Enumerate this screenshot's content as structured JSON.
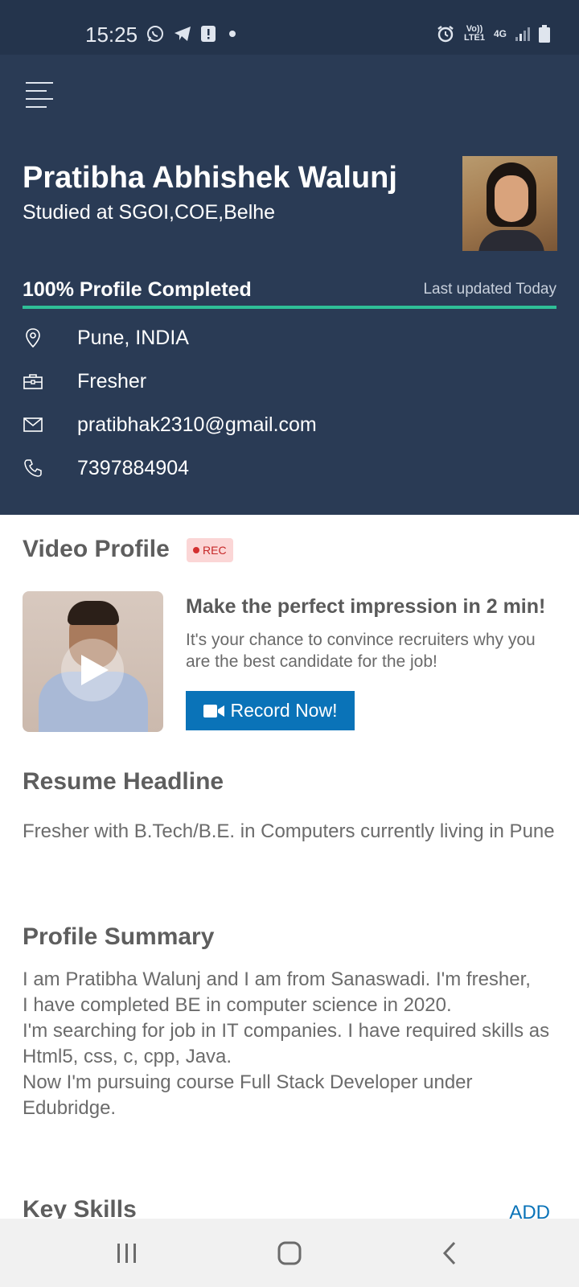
{
  "status_bar": {
    "time": "15:25",
    "left_icons": [
      "whatsapp-icon",
      "telegram-icon",
      "alert-icon",
      "dot-icon"
    ],
    "right_icons": [
      "alarm-icon",
      "volte-icon",
      "4g-icon",
      "signal-icon",
      "battery-icon"
    ],
    "volte_label": "Vo)) LTE1",
    "network_label": "4G"
  },
  "header": {
    "name": "Pratibha Abhishek Walunj",
    "studied": "Studied at SGOI,COE,Belhe",
    "progress_label": "100% Profile Completed",
    "progress_percent": 100,
    "last_updated": "Last updated Today",
    "location": "Pune, INDIA",
    "experience": "Fresher",
    "email": "pratibhak2310@gmail.com",
    "phone": "7397884904"
  },
  "video_profile": {
    "title": "Video Profile",
    "badge": "REC",
    "headline": "Make the perfect impression in 2 min!",
    "description": "It's your chance to convince recruiters why you are the best candidate for the job!",
    "button_label": "Record Now!"
  },
  "resume_headline": {
    "title": "Resume Headline",
    "text": "Fresher  with B.Tech/B.E. in Computers currently living in Pune"
  },
  "profile_summary": {
    "title": "Profile Summary",
    "text": "I am Pratibha Walunj and I am from Sanaswadi. I'm fresher,\nI have completed BE in computer science in 2020.\nI'm searching for job in IT companies. I have required skills as Html5, css, c, cpp, Java.\nNow I'm pursuing course Full Stack Developer under Edubridge."
  },
  "key_skills": {
    "title": "Key Skills",
    "add_label": "ADD"
  },
  "colors": {
    "header_bg": "#2a3b55",
    "status_bg": "#24344c",
    "progress": "#2fbf97",
    "accent": "#0a73b8"
  }
}
